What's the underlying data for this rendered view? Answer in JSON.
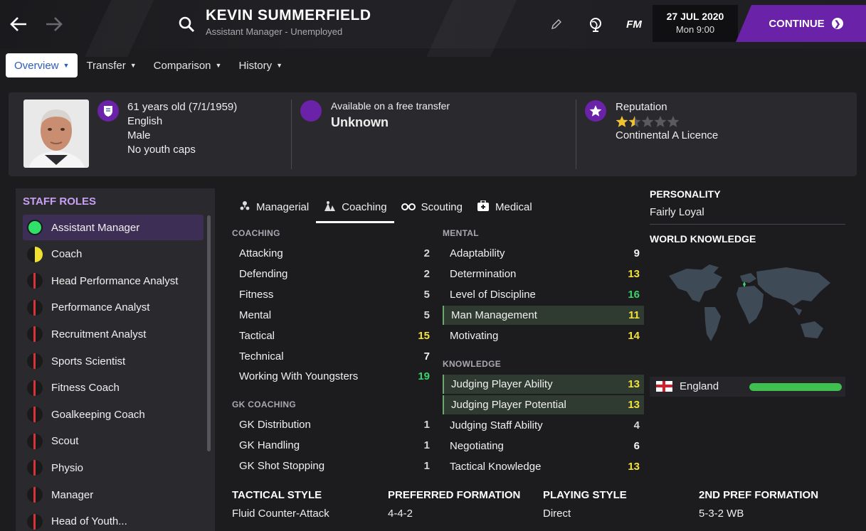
{
  "header": {
    "name": "KEVIN SUMMERFIELD",
    "subtitle": "Assistant Manager - Unemployed",
    "date": "27 JUL 2020",
    "time": "Mon 9:00",
    "fm_label": "FM",
    "continue_label": "CONTINUE"
  },
  "tabs": [
    {
      "label": "Overview",
      "active": true
    },
    {
      "label": "Transfer",
      "active": false
    },
    {
      "label": "Comparison",
      "active": false
    },
    {
      "label": "History",
      "active": false
    }
  ],
  "profile": {
    "age_dob": "61 years old (7/1/1959)",
    "nationality": "English",
    "gender": "Male",
    "youth_caps": "No youth caps",
    "transfer_status": "Available on a free transfer",
    "transfer_value": "Unknown",
    "reputation_label": "Reputation",
    "reputation_stars": 1.5,
    "reputation_max": 5,
    "licence": "Continental A Licence"
  },
  "staff_roles": {
    "title": "STAFF ROLES",
    "items": [
      {
        "label": "Assistant Manager",
        "status": "green"
      },
      {
        "label": "Coach",
        "status": "yellow"
      },
      {
        "label": "Head Performance Analyst",
        "status": "red"
      },
      {
        "label": "Performance Analyst",
        "status": "red"
      },
      {
        "label": "Recruitment Analyst",
        "status": "red"
      },
      {
        "label": "Sports Scientist",
        "status": "red"
      },
      {
        "label": "Fitness Coach",
        "status": "red"
      },
      {
        "label": "Goalkeeping Coach",
        "status": "red"
      },
      {
        "label": "Scout",
        "status": "red"
      },
      {
        "label": "Physio",
        "status": "red"
      },
      {
        "label": "Manager",
        "status": "red"
      },
      {
        "label": "Head of Youth...",
        "status": "red"
      }
    ]
  },
  "subtabs": [
    {
      "label": "Managerial",
      "icon": "managerial-icon"
    },
    {
      "label": "Coaching",
      "icon": "coaching-icon",
      "active": true
    },
    {
      "label": "Scouting",
      "icon": "binoculars-icon"
    },
    {
      "label": "Medical",
      "icon": "medical-kit-icon"
    }
  ],
  "coaching": {
    "title": "COACHING",
    "items": [
      {
        "label": "Attacking",
        "value": "2"
      },
      {
        "label": "Defending",
        "value": "2"
      },
      {
        "label": "Fitness",
        "value": "5"
      },
      {
        "label": "Mental",
        "value": "5"
      },
      {
        "label": "Tactical",
        "value": "15"
      },
      {
        "label": "Technical",
        "value": "7"
      },
      {
        "label": "Working With Youngsters",
        "value": "19"
      }
    ]
  },
  "gk_coaching": {
    "title": "GK COACHING",
    "items": [
      {
        "label": "GK Distribution",
        "value": "1"
      },
      {
        "label": "GK Handling",
        "value": "1"
      },
      {
        "label": "GK Shot Stopping",
        "value": "1"
      }
    ]
  },
  "mental": {
    "title": "MENTAL",
    "items": [
      {
        "label": "Adaptability",
        "value": "9"
      },
      {
        "label": "Determination",
        "value": "13"
      },
      {
        "label": "Level of Discipline",
        "value": "16"
      },
      {
        "label": "Man Management",
        "value": "11",
        "highlight": true
      },
      {
        "label": "Motivating",
        "value": "14"
      }
    ]
  },
  "knowledge": {
    "title": "KNOWLEDGE",
    "items": [
      {
        "label": "Judging Player Ability",
        "value": "13",
        "highlight": true
      },
      {
        "label": "Judging Player Potential",
        "value": "13",
        "highlight": true
      },
      {
        "label": "Judging Staff Ability",
        "value": "4"
      },
      {
        "label": "Negotiating",
        "value": "6"
      },
      {
        "label": "Tactical Knowledge",
        "value": "13"
      }
    ]
  },
  "personality": {
    "title": "PERSONALITY",
    "value": "Fairly Loyal"
  },
  "world_knowledge": {
    "title": "WORLD KNOWLEDGE",
    "country": "England",
    "level": 1.0
  },
  "bottom": {
    "tactical_style_label": "TACTICAL STYLE",
    "tactical_style": "Fluid Counter-Attack",
    "preferred_formation_label": "PREFERRED FORMATION",
    "preferred_formation": "4-4-2",
    "playing_style_label": "PLAYING STYLE",
    "playing_style": "Direct",
    "second_formation_label": "2ND PREF FORMATION",
    "second_formation": "5-3-2 WB"
  },
  "colors": {
    "accent": "#6a22a8",
    "value_low": "#d7d7d7",
    "value_mid": "#f2f2f2",
    "value_good": "#f2e23a",
    "value_great": "#3bd16b"
  }
}
